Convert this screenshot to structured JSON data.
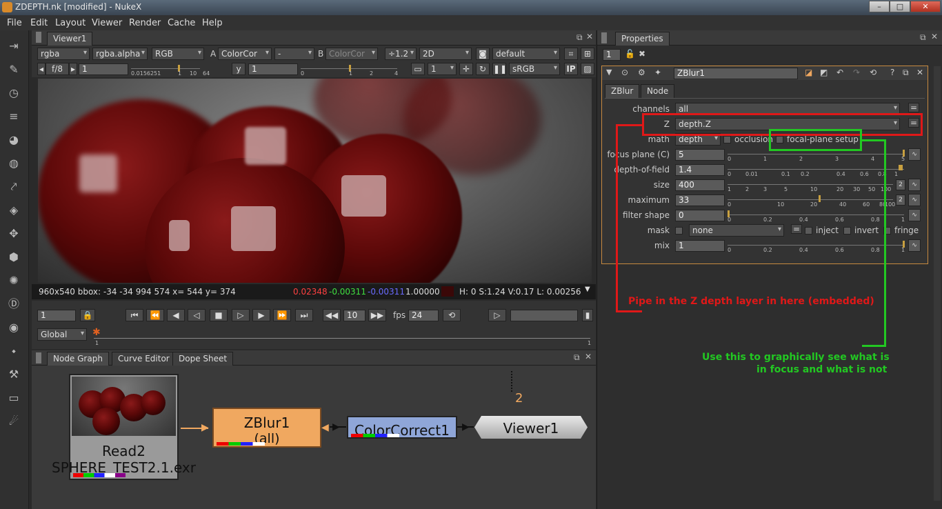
{
  "window": {
    "title": "ZDEPTH.nk [modified] - NukeX",
    "min": "–",
    "max": "□",
    "close": "✕"
  },
  "menu": [
    "File",
    "Edit",
    "Layout",
    "Viewer",
    "Render",
    "Cache",
    "Help"
  ],
  "viewer": {
    "tab": "Viewer1",
    "row1": {
      "channels": "rgba",
      "alpha": "rgba.alpha",
      "lut": "RGB",
      "a_label": "A",
      "a_input": "ColorCor",
      "dash": "-",
      "b_label": "B",
      "b_input": "ColorCor",
      "zoom": "÷1.2",
      "mode": "2D",
      "look": "default"
    },
    "row2": {
      "fstop": "f/8",
      "gain": "1",
      "gain_ticks": [
        "0.01562",
        "51",
        "1",
        "10",
        "64"
      ],
      "gamma_label": "y",
      "gamma": "1",
      "gamma_ticks": [
        "0",
        "1",
        "2",
        "4"
      ],
      "proxy": "1",
      "colorspace": "sRGB",
      "ip": "IP"
    },
    "status": {
      "info": "960x540 bbox: -34 -34 994 574  x= 544 y= 374",
      "r": "0.02348",
      "g": "-0.00311",
      "b": "-0.00311",
      "a": "1.00000 !",
      "hsv": "H:  0 S:1.24 V:0.17  L: 0.00256"
    },
    "timeline": {
      "frame": "1",
      "step": "10",
      "fps_label": "fps",
      "fps": "24",
      "scope": "Global",
      "start": "1",
      "end": "1"
    }
  },
  "nodegraph": {
    "tabs": [
      "Node Graph",
      "Curve Editor",
      "Dope Sheet"
    ],
    "nodes": {
      "read_name": "Read2",
      "read_file": "SPHERE_TEST2.1.exr",
      "zblur_name": "ZBlur1",
      "zblur_sub": "(all)",
      "cc_name": "ColorCorrect1",
      "viewer_name": "Viewer1",
      "viewer_input": "2"
    }
  },
  "properties": {
    "tab": "Properties",
    "count": "1",
    "node_name": "ZBlur1",
    "tabs": [
      "ZBlur",
      "Node"
    ],
    "channels_label": "channels",
    "channels": "all",
    "z_label": "Z",
    "z": "depth.Z",
    "math_label": "math",
    "math": "depth",
    "occlusion": "occlusion",
    "focal": "focal-plane setup",
    "focus_label": "focus plane (C)",
    "focus": "5",
    "focus_ticks": [
      "0",
      "1",
      "2",
      "3",
      "4",
      "5"
    ],
    "dof_label": "depth-of-field",
    "dof": "1.4",
    "dof_ticks": [
      "0",
      "0.01",
      "0.1",
      "0.2",
      "0.4",
      "0.6",
      "0.8",
      "1"
    ],
    "size_label": "size",
    "size": "400",
    "size_ticks": [
      "1",
      "2",
      "3",
      "5",
      "10",
      "20",
      "30",
      "50",
      "100"
    ],
    "size_btn": "2",
    "max_label": "maximum",
    "max": "33",
    "max_ticks": [
      "0",
      "10",
      "20",
      "40",
      "60",
      "80",
      "100"
    ],
    "max_btn": "2",
    "filter_label": "filter shape",
    "filter": "0",
    "filter_ticks": [
      "0",
      "0.2",
      "0.4",
      "0.6",
      "0.8",
      "1"
    ],
    "mask_label": "mask",
    "mask": "none",
    "inject": "inject",
    "invert": "invert",
    "fringe": "fringe",
    "mix_label": "mix",
    "mix": "1",
    "mix_ticks": [
      "0",
      "0.2",
      "0.4",
      "0.6",
      "0.8",
      "1"
    ]
  },
  "annotations": {
    "red": "Pipe in the Z depth layer in here (embedded)",
    "green1": "Use this to graphically see what is",
    "green2": "in focus and what is not"
  },
  "colors": {
    "red": "#e01818",
    "green": "#22c822",
    "zblur_node": "#f0a860",
    "cc_node": "#8fa6d8"
  }
}
